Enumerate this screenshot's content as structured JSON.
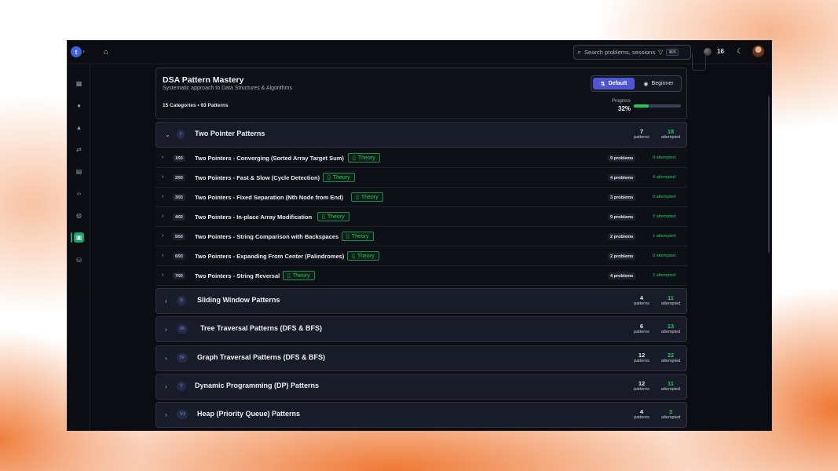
{
  "topbar": {
    "logo_letter": "t",
    "search_placeholder": "Search problems, sessions,",
    "search_shortcut": "⌘K",
    "points": "16"
  },
  "sidebar": {
    "items": [
      {
        "icon": "dashboard-icon",
        "glyph": "▦"
      },
      {
        "icon": "mic-icon",
        "glyph": "●"
      },
      {
        "icon": "graduation-cap-icon",
        "glyph": "▲"
      },
      {
        "icon": "swap-icon",
        "glyph": "⇄"
      },
      {
        "icon": "document-icon",
        "glyph": "▤"
      },
      {
        "icon": "code-icon",
        "glyph": "‹›"
      },
      {
        "icon": "users-icon",
        "glyph": "◍"
      },
      {
        "icon": "patterns-icon",
        "glyph": "▣",
        "active": true
      },
      {
        "icon": "database-icon",
        "glyph": "⛁"
      }
    ]
  },
  "header": {
    "title": "DSA Pattern Mastery",
    "subtitle": "Systematic approach to Data Structures & Algorithms",
    "meta": "15 Categories • 93 Patterns",
    "modes": [
      "Default",
      "Beginner"
    ],
    "active_mode": "Default",
    "progress_label": "Progress",
    "progress_value": "32%",
    "progress_fraction": 0.32
  },
  "labels": {
    "patterns": "patterns",
    "attempted": "attempted",
    "theory": "Theory"
  },
  "categories": [
    {
      "roman": "I",
      "title": "Two Pointer Patterns",
      "patterns": "7",
      "attempted": "18",
      "expanded": true
    },
    {
      "roman": "II",
      "title": "Sliding Window Patterns",
      "patterns": "4",
      "attempted": "11"
    },
    {
      "roman": "III",
      "title": "Tree Traversal Patterns (DFS & BFS)",
      "patterns": "6",
      "attempted": "13"
    },
    {
      "roman": "IV",
      "title": "Graph Traversal Patterns (DFS & BFS)",
      "patterns": "12",
      "attempted": "22"
    },
    {
      "roman": "V",
      "title": "Dynamic Programming (DP) Patterns",
      "patterns": "12",
      "attempted": "11"
    },
    {
      "roman": "VI",
      "title": "Heap (Priority Queue) Patterns",
      "patterns": "4",
      "attempted": "3"
    }
  ],
  "patterns": [
    {
      "index": "1/93",
      "name": "Two Pointers - Converging (Sorted Array Target Sum)",
      "problems": "9 problems",
      "attempted": "9 attempted"
    },
    {
      "index": "2/93",
      "name": "Two Pointers - Fast & Slow (Cycle Detection)",
      "problems": "4 problems",
      "attempted": "4 attempted"
    },
    {
      "index": "3/93",
      "name": "Two Pointers - Fixed Separation (Nth Node from End)",
      "problems": "3 problems",
      "attempted": "0 attempted"
    },
    {
      "index": "4/93",
      "name": "Two Pointers - In-place Array Modification",
      "problems": "9 problems",
      "attempted": "2 attempted"
    },
    {
      "index": "5/93",
      "name": "Two Pointers - String Comparison with Backspaces",
      "problems": "2 problems",
      "attempted": "1 attempted"
    },
    {
      "index": "6/93",
      "name": "Two Pointers - Expanding From Center (Palindromes)",
      "problems": "2 problems",
      "attempted": "0 attempted"
    },
    {
      "index": "7/93",
      "name": "Two Pointers - String Reversal",
      "problems": "4 problems",
      "attempted": "2 attempted"
    }
  ]
}
